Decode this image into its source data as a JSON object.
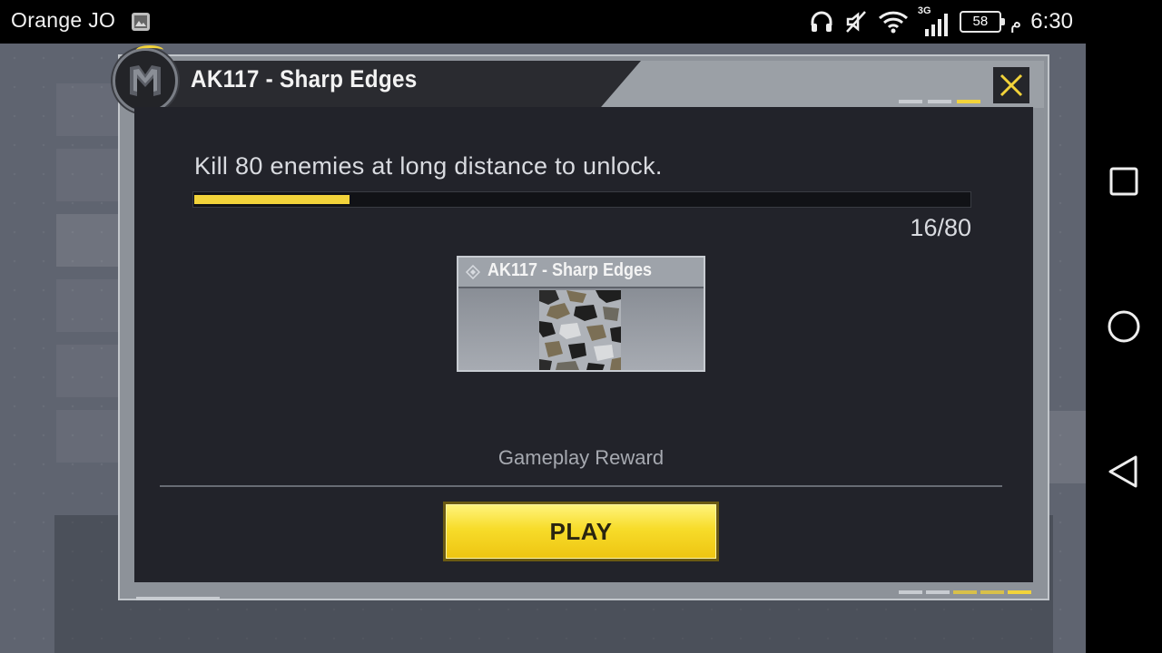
{
  "status_bar": {
    "carrier": "Orange JO",
    "battery": "58",
    "ampm": "م",
    "time": "6:30",
    "network": "3G"
  },
  "dialog": {
    "title": "AK117 - Sharp Edges",
    "task": "Kill 80 enemies at long distance to unlock.",
    "progress": {
      "current": 16,
      "total": 80,
      "label": "16/80"
    },
    "reward_card_title": "AK117 - Sharp Edges",
    "reward_label": "Gameplay Reward",
    "play_button": "PLAY"
  },
  "colors": {
    "accent_yellow": "#f2d33a",
    "panel_dark": "#22232a",
    "frame_gray": "#8d9299"
  },
  "icons": [
    "gallery-icon",
    "headphones-icon",
    "mute-icon",
    "wifi-icon",
    "signal-icon",
    "battery-icon",
    "close-icon",
    "diamond-icon",
    "recent-apps-icon",
    "home-icon",
    "back-icon"
  ]
}
